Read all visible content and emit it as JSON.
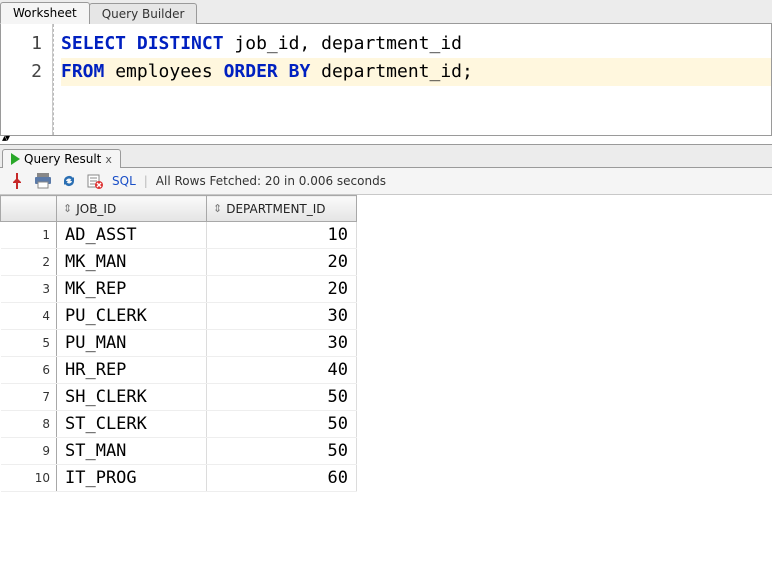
{
  "tabs": {
    "worksheet": "Worksheet",
    "queryBuilder": "Query Builder"
  },
  "editor": {
    "lineNumbers": [
      "1",
      "2"
    ],
    "lines": [
      {
        "tokens": [
          {
            "t": "SELECT",
            "k": true
          },
          {
            "t": " "
          },
          {
            "t": "DISTINCT",
            "k": true
          },
          {
            "t": " job_id, department_id"
          }
        ],
        "current": false
      },
      {
        "tokens": [
          {
            "t": "FROM",
            "k": true
          },
          {
            "t": " employees "
          },
          {
            "t": "ORDER",
            "k": true
          },
          {
            "t": " "
          },
          {
            "t": "BY",
            "k": true
          },
          {
            "t": " department_id;"
          }
        ],
        "current": true
      }
    ]
  },
  "resultTab": {
    "label": "Query Result",
    "close": "x"
  },
  "toolbar": {
    "sqlLabel": "SQL",
    "status": "All Rows Fetched: 20 in 0.006 seconds"
  },
  "grid": {
    "columns": {
      "job": "JOB_ID",
      "dept": "DEPARTMENT_ID"
    },
    "rows": [
      {
        "n": "1",
        "job": "AD_ASST",
        "dept": "10"
      },
      {
        "n": "2",
        "job": "MK_MAN",
        "dept": "20"
      },
      {
        "n": "3",
        "job": "MK_REP",
        "dept": "20"
      },
      {
        "n": "4",
        "job": "PU_CLERK",
        "dept": "30"
      },
      {
        "n": "5",
        "job": "PU_MAN",
        "dept": "30"
      },
      {
        "n": "6",
        "job": "HR_REP",
        "dept": "40"
      },
      {
        "n": "7",
        "job": "SH_CLERK",
        "dept": "50"
      },
      {
        "n": "8",
        "job": "ST_CLERK",
        "dept": "50"
      },
      {
        "n": "9",
        "job": "ST_MAN",
        "dept": "50"
      },
      {
        "n": "10",
        "job": "IT_PROG",
        "dept": "60"
      }
    ]
  }
}
